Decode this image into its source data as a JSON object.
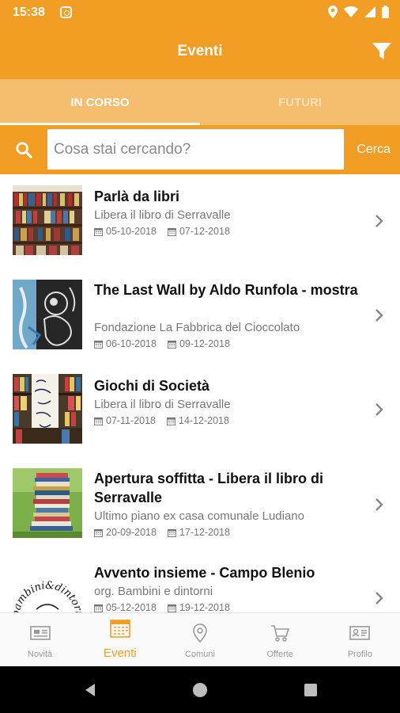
{
  "status_bar": {
    "time": "15:38",
    "icons": [
      "instagram-icon",
      "location-icon",
      "wifi-icon",
      "signal-icon",
      "battery-icon"
    ]
  },
  "app_bar": {
    "title": "Eventi",
    "filter_icon": "filter-icon"
  },
  "tabs": [
    {
      "label": "IN CORSO",
      "active": true
    },
    {
      "label": "FUTURI",
      "active": false
    }
  ],
  "search": {
    "placeholder": "Cosa stai cercando?",
    "value": "",
    "button_label": "Cerca"
  },
  "events": [
    {
      "title": "Parlà da libri",
      "subtitle": "Libera il libro di Serravalle",
      "start_date": "05-10-2018",
      "end_date": "07-12-2018",
      "thumb": "bookshelf"
    },
    {
      "title": "The Last Wall by Aldo Runfola - mostra",
      "subtitle": "Fondazione La Fabbrica del Cioccolato",
      "start_date": "06-10-2018",
      "end_date": "09-12-2018",
      "thumb": "art"
    },
    {
      "title": "Giochi di Società",
      "subtitle": "Libera il libro di Serravalle",
      "start_date": "07-11-2018",
      "end_date": "14-12-2018",
      "thumb": "games"
    },
    {
      "title": "Apertura soffitta - Libera il libro di Serravalle",
      "subtitle": "Ultimo piano ex casa comunale Ludiano",
      "start_date": "20-09-2018",
      "end_date": "17-12-2018",
      "thumb": "books-grass"
    },
    {
      "title": "Avvento insieme - Campo Blenio",
      "subtitle": "org. Bambini e dintorni",
      "start_date": "05-12-2018",
      "end_date": "19-12-2018",
      "thumb": "logo"
    }
  ],
  "bottom_nav": [
    {
      "label": "Novità",
      "icon": "newspaper-icon",
      "active": false
    },
    {
      "label": "Eventi",
      "icon": "calendar-icon",
      "active": true
    },
    {
      "label": "Comuni",
      "icon": "map-pin-icon",
      "active": false
    },
    {
      "label": "Offerte",
      "icon": "cart-icon",
      "active": false
    },
    {
      "label": "Profilo",
      "icon": "id-card-icon",
      "active": false
    }
  ],
  "thumb_logo_text": "bambini&dintorni",
  "colors": {
    "primary": "#f29e25",
    "tab_bg": "#f5bd6e",
    "text_dark": "#111111",
    "text_muted": "#777777"
  }
}
